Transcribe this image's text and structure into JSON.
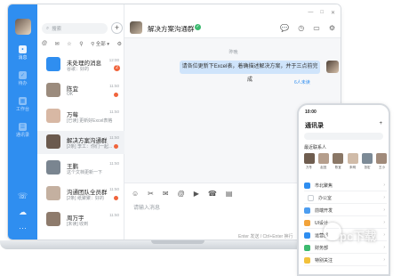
{
  "nav": {
    "items": [
      {
        "label": "消息",
        "icon": "message-icon"
      },
      {
        "label": "待办",
        "icon": "todo-icon"
      },
      {
        "label": "工作台",
        "icon": "workbench-icon"
      },
      {
        "label": "通讯录",
        "icon": "contacts-icon"
      }
    ],
    "bottom": [
      {
        "glyph": "☏",
        "icon": "phone-icon"
      },
      {
        "glyph": "☁",
        "icon": "cloud-icon"
      },
      {
        "glyph": "···",
        "icon": "more-icon"
      }
    ]
  },
  "list": {
    "search_placeholder": "搜索",
    "add_glyph": "+",
    "filter_all": "全部",
    "conversations": [
      {
        "name": "未处理的消息",
        "msg": "谷歌：好的",
        "time": "12:00",
        "marker": "badge",
        "badge": "2",
        "avatar": "#2f8ef0"
      },
      {
        "name": "陈宜",
        "msg": "OK",
        "time": "11:50",
        "marker": "dot",
        "avatar": "#9b8b7d"
      },
      {
        "name": "万莓",
        "msg": "[已读] 更新好Excel表格",
        "time": "11:50",
        "marker": "none",
        "avatar": "#d8b8a4"
      },
      {
        "name": "解决方案沟通群",
        "msg": "[2条] 李工：你们一起...",
        "time": "11:50",
        "marker": "dot",
        "avatar": "#6b5a4e"
      },
      {
        "name": "王鹏",
        "msg": "这个文档更新一下",
        "time": "11:50",
        "marker": "none",
        "avatar": "#7a8590"
      },
      {
        "name": "沟通团队全员群",
        "msg": "[2条] 纸聚聚：好的",
        "time": "11:50",
        "marker": "dot",
        "avatar": "#c4b0a0"
      },
      {
        "name": "周万宇",
        "msg": "[未读] 收到",
        "time": "11:50",
        "marker": "none",
        "avatar": "#8e7b6c"
      }
    ],
    "active_index": 3
  },
  "chat": {
    "title": "解决方案沟通群",
    "verified_glyph": "✓",
    "time_separator": "昨晚",
    "message": "请各位更新下Excel表，着确描述解决方案，并于三点前完成",
    "unread_label": "6人未读",
    "composer_placeholder": "请输入消息",
    "send_hint": "Enter 发送 / Ctrl+Enter 换行",
    "window_controls": [
      "—",
      "□",
      "✕"
    ],
    "head_tools": [
      {
        "glyph": "💬",
        "icon": "chat-bubble-icon"
      },
      {
        "glyph": "◷",
        "icon": "clock-icon"
      },
      {
        "glyph": "▭",
        "icon": "folder-icon"
      },
      {
        "glyph": "⚙",
        "icon": "settings-icon"
      }
    ],
    "composer_tools": [
      {
        "glyph": "☺",
        "icon": "emoji-icon"
      },
      {
        "glyph": "✂",
        "icon": "scissors-icon"
      },
      {
        "glyph": "✉",
        "icon": "mail-icon"
      },
      {
        "glyph": "@",
        "icon": "at-icon"
      },
      {
        "glyph": "▶",
        "icon": "video-icon"
      },
      {
        "glyph": "☎",
        "icon": "call-icon"
      },
      {
        "glyph": "▤",
        "icon": "file-icon"
      }
    ]
  },
  "phone": {
    "status_time": "10:00",
    "title": "通讯录",
    "add_glyph": "+",
    "recent_label": "最近联系人",
    "contacts": [
      {
        "name": "万冬",
        "color": "#6f5d4f"
      },
      {
        "name": "赵宜",
        "color": "#b59e8c"
      },
      {
        "name": "陈宜",
        "color": "#8a7766"
      },
      {
        "name": "朱明",
        "color": "#d0bba8"
      },
      {
        "name": "张宏",
        "color": "#7c8a96"
      },
      {
        "name": "王小",
        "color": "#a08a7a"
      }
    ],
    "rows": [
      {
        "label": "市北聚焦",
        "color": "#2f8ef0",
        "sub": false
      },
      {
        "label": "办公室",
        "color": "#ffffff",
        "sub": true
      },
      {
        "label": "前端开发",
        "color": "#4c9df0",
        "sub": false
      },
      {
        "label": "UI设计",
        "color": "#f2a33a",
        "sub": false
      },
      {
        "label": "运营部",
        "color": "#2f8ef0",
        "sub": false
      },
      {
        "label": "财务部",
        "color": "#3cba6f",
        "sub": false
      },
      {
        "label": "特别关注",
        "color": "#f2c13a",
        "sub": false
      }
    ]
  },
  "watermark": "pc下载"
}
